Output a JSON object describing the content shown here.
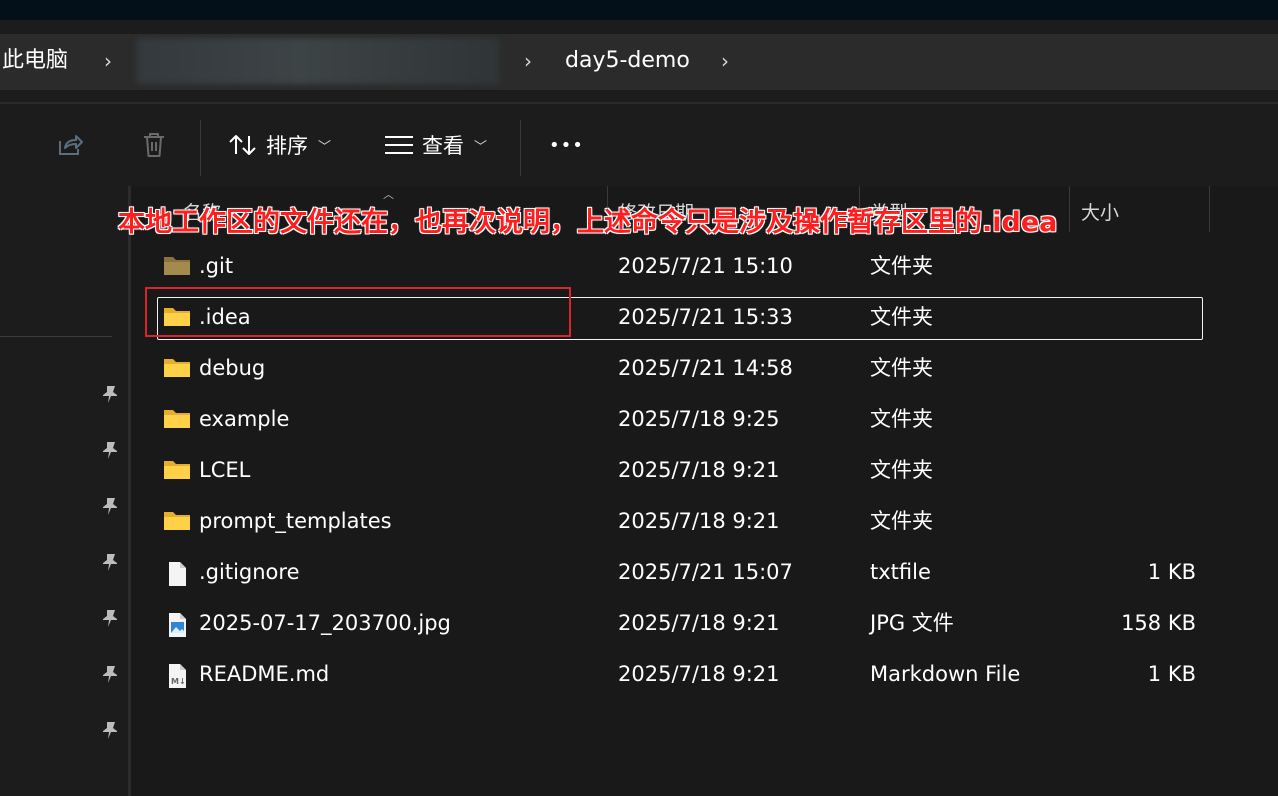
{
  "address": {
    "crumbs": [
      "此电脑",
      "day5-demo"
    ],
    "separator": "›"
  },
  "toolbar": {
    "sort_label": "排序",
    "view_label": "查看",
    "more_label": "•••",
    "share_icon": "share-icon",
    "delete_icon": "delete-icon"
  },
  "columns": {
    "name": "名称",
    "modified": "修改日期",
    "type": "类型",
    "size": "大小"
  },
  "annotation": "本地工作区的文件还在，也再次说明，上述命令只是涉及操作暂存区里的.idea",
  "files": [
    {
      "name": ".git",
      "modified": "2025/7/21 15:10",
      "type": "文件夹",
      "size": "",
      "icon": "folder-icon"
    },
    {
      "name": ".idea",
      "modified": "2025/7/21 15:33",
      "type": "文件夹",
      "size": "",
      "icon": "folder-icon"
    },
    {
      "name": "debug",
      "modified": "2025/7/21 14:58",
      "type": "文件夹",
      "size": "",
      "icon": "folder-icon"
    },
    {
      "name": "example",
      "modified": "2025/7/18 9:25",
      "type": "文件夹",
      "size": "",
      "icon": "folder-icon"
    },
    {
      "name": "LCEL",
      "modified": "2025/7/18 9:21",
      "type": "文件夹",
      "size": "",
      "icon": "folder-icon"
    },
    {
      "name": "prompt_templates",
      "modified": "2025/7/18 9:21",
      "type": "文件夹",
      "size": "",
      "icon": "folder-icon"
    },
    {
      "name": ".gitignore",
      "modified": "2025/7/21 15:07",
      "type": "txtfile",
      "size": "1 KB",
      "icon": "text-file-icon"
    },
    {
      "name": "2025-07-17_203700.jpg",
      "modified": "2025/7/18 9:21",
      "type": "JPG 文件",
      "size": "158 KB",
      "icon": "image-file-icon"
    },
    {
      "name": "README.md",
      "modified": "2025/7/18 9:21",
      "type": "Markdown File",
      "size": "1 KB",
      "icon": "markdown-file-icon"
    }
  ],
  "colors": {
    "folder": "#f5c542",
    "annotation": "#ff1d1d",
    "highlight_box": "#d8262b"
  }
}
